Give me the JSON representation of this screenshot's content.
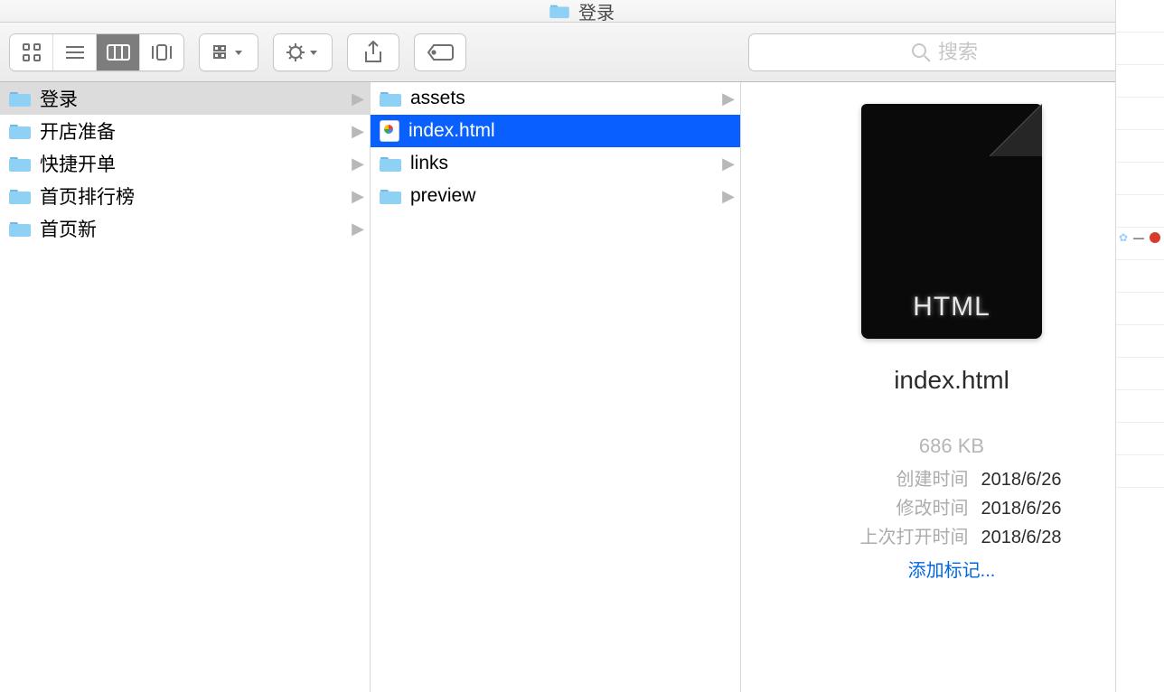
{
  "title": {
    "folder_name": "登录"
  },
  "search": {
    "placeholder": "搜索"
  },
  "col1": {
    "items": [
      {
        "label": "登录",
        "selected": true
      },
      {
        "label": "开店准备",
        "selected": false
      },
      {
        "label": "快捷开单",
        "selected": false
      },
      {
        "label": "首页排行榜",
        "selected": false
      },
      {
        "label": "首页新",
        "selected": false
      }
    ]
  },
  "col2": {
    "items": [
      {
        "label": "assets",
        "type": "folder",
        "selected": false
      },
      {
        "label": "index.html",
        "type": "file",
        "selected": true
      },
      {
        "label": "links",
        "type": "folder",
        "selected": false
      },
      {
        "label": "preview",
        "type": "folder",
        "selected": false
      }
    ]
  },
  "preview": {
    "badge_text": "HTML",
    "file_name": "index.html",
    "size": "686 KB",
    "meta": {
      "created_label": "创建时间",
      "created_value": "2018/6/26",
      "modified_label": "修改时间",
      "modified_value": "2018/6/26",
      "opened_label": "上次打开时间",
      "opened_value": "2018/6/28"
    },
    "add_tag_label": "添加标记..."
  }
}
